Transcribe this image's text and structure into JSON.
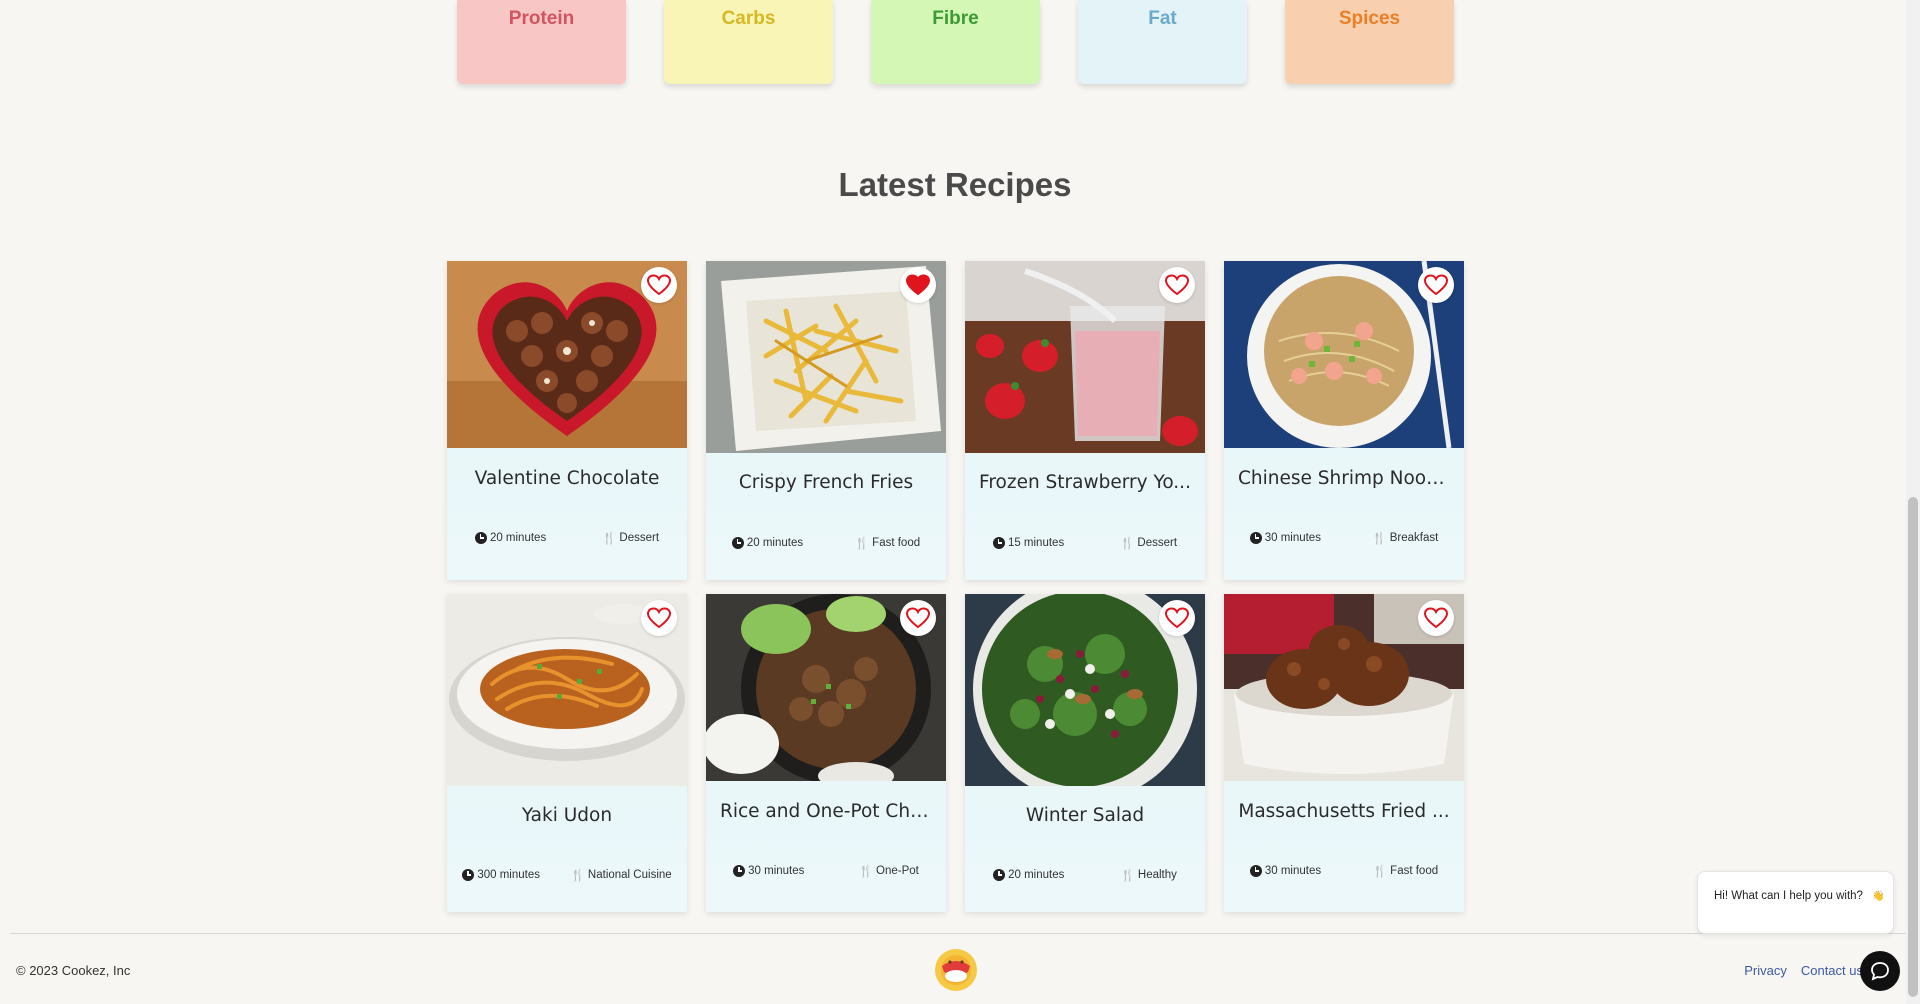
{
  "categories": [
    {
      "label": "Protein",
      "bg": "#f9c6c6",
      "fg": "#d1545f"
    },
    {
      "label": "Carbs",
      "bg": "#f9f5b6",
      "fg": "#d6b824"
    },
    {
      "label": "Fibre",
      "bg": "#d4f7b6",
      "fg": "#3e9a35"
    },
    {
      "label": "Fat",
      "bg": "#e3f3f7",
      "fg": "#6aa9c9"
    },
    {
      "label": "Spices",
      "bg": "#f8d0b0",
      "fg": "#e97f27"
    }
  ],
  "section": {
    "title": "Latest Recipes"
  },
  "recipes": [
    {
      "title": "Valentine Chocolate",
      "time": "20 minutes",
      "category": "Dessert",
      "favorited": false,
      "image": "heart-chocolate-box-image"
    },
    {
      "title": "Crispy French Fries",
      "time": "20 minutes",
      "category": "Fast food",
      "favorited": true,
      "image": "french-fries-image"
    },
    {
      "title": "Frozen Strawberry Yo...",
      "time": "15 minutes",
      "category": "Dessert",
      "favorited": false,
      "image": "strawberry-smoothie-image"
    },
    {
      "title": "Chinese Shrimp Nood...",
      "time": "30 minutes",
      "category": "Breakfast",
      "favorited": false,
      "image": "shrimp-noodle-soup-image"
    },
    {
      "title": "Yaki Udon",
      "time": "300 minutes",
      "category": "National Cuisine",
      "favorited": false,
      "image": "udon-noodles-image"
    },
    {
      "title": "Rice and One-Pot Chi...",
      "time": "30 minutes",
      "category": "One-Pot",
      "favorited": false,
      "image": "chicken-rice-bokchoy-image"
    },
    {
      "title": "Winter Salad",
      "time": "20 minutes",
      "category": "Healthy",
      "favorited": false,
      "image": "winter-salad-image"
    },
    {
      "title": "Massachusetts Fried ...",
      "time": "30 minutes",
      "category": "Fast food",
      "favorited": false,
      "image": "fried-chicken-image"
    }
  ],
  "footer": {
    "copyright": "© 2023 Cookez, Inc",
    "links": [
      "Privacy",
      "Contact us"
    ]
  },
  "chat": {
    "greeting": "Hi! What can I help you with?"
  },
  "colors": {
    "accent_red": "#e0141e",
    "card_bg": "#e2f5f8",
    "page_bg": "#f7f6f2"
  }
}
